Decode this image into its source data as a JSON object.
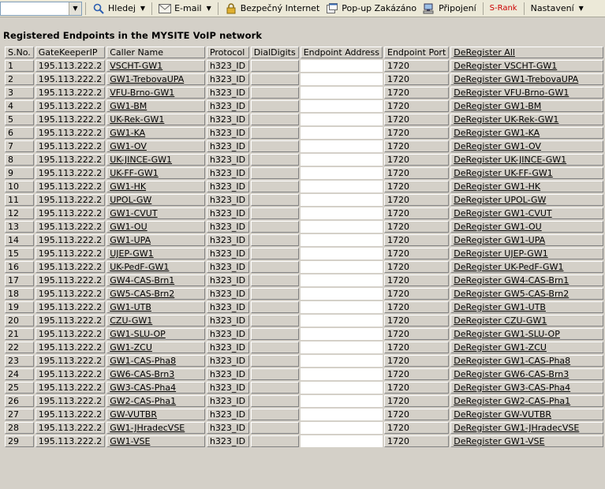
{
  "toolbar": {
    "search_label": "Hledej",
    "email_label": "E-mail",
    "secure_label": "Bezpečný Internet",
    "popup_label": "Pop-up Zakázáno",
    "connect_label": "Připojení",
    "srank_label": "S-Rank",
    "settings_label": "Nastavení"
  },
  "page": {
    "heading": "Registered Endpoints in the MYSITE VoIP network"
  },
  "table": {
    "headers": [
      "S.No.",
      "GateKeeperIP",
      "Caller Name",
      "Protocol",
      "DialDigits",
      "Endpoint Address",
      "Endpoint Port",
      "DeRegister All"
    ],
    "rows": [
      [
        "1",
        "195.113.222.2",
        "VSCHT-GW1",
        "h323_ID",
        "",
        "",
        "1720",
        "DeRegister VSCHT-GW1"
      ],
      [
        "2",
        "195.113.222.2",
        "GW1-TrebovaUPA",
        "h323_ID",
        "",
        "",
        "1720",
        "DeRegister GW1-TrebovaUPA"
      ],
      [
        "3",
        "195.113.222.2",
        "VFU-Brno-GW1",
        "h323_ID",
        "",
        "",
        "1720",
        "DeRegister VFU-Brno-GW1"
      ],
      [
        "4",
        "195.113.222.2",
        "GW1-BM",
        "h323_ID",
        "",
        "",
        "1720",
        "DeRegister GW1-BM"
      ],
      [
        "5",
        "195.113.222.2",
        "UK-Rek-GW1",
        "h323_ID",
        "",
        "",
        "1720",
        "DeRegister UK-Rek-GW1"
      ],
      [
        "6",
        "195.113.222.2",
        "GW1-KA",
        "h323_ID",
        "",
        "",
        "1720",
        "DeRegister GW1-KA"
      ],
      [
        "7",
        "195.113.222.2",
        "GW1-OV",
        "h323_ID",
        "",
        "",
        "1720",
        "DeRegister GW1-OV"
      ],
      [
        "8",
        "195.113.222.2",
        "UK-JINCE-GW1",
        "h323_ID",
        "",
        "",
        "1720",
        "DeRegister UK-JINCE-GW1"
      ],
      [
        "9",
        "195.113.222.2",
        "UK-FF-GW1",
        "h323_ID",
        "",
        "",
        "1720",
        "DeRegister UK-FF-GW1"
      ],
      [
        "10",
        "195.113.222.2",
        "GW1-HK",
        "h323_ID",
        "",
        "",
        "1720",
        "DeRegister GW1-HK"
      ],
      [
        "11",
        "195.113.222.2",
        "UPOL-GW",
        "h323_ID",
        "",
        "",
        "1720",
        "DeRegister UPOL-GW"
      ],
      [
        "12",
        "195.113.222.2",
        "GW1-CVUT",
        "h323_ID",
        "",
        "",
        "1720",
        "DeRegister GW1-CVUT"
      ],
      [
        "13",
        "195.113.222.2",
        "GW1-OU",
        "h323_ID",
        "",
        "",
        "1720",
        "DeRegister GW1-OU"
      ],
      [
        "14",
        "195.113.222.2",
        "GW1-UPA",
        "h323_ID",
        "",
        "",
        "1720",
        "DeRegister GW1-UPA"
      ],
      [
        "15",
        "195.113.222.2",
        "UJEP-GW1",
        "h323_ID",
        "",
        "",
        "1720",
        "DeRegister UJEP-GW1"
      ],
      [
        "16",
        "195.113.222.2",
        "UK-PedF-GW1",
        "h323_ID",
        "",
        "",
        "1720",
        "DeRegister UK-PedF-GW1"
      ],
      [
        "17",
        "195.113.222.2",
        "GW4-CAS-Brn1",
        "h323_ID",
        "",
        "",
        "1720",
        "DeRegister GW4-CAS-Brn1"
      ],
      [
        "18",
        "195.113.222.2",
        "GW5-CAS-Brn2",
        "h323_ID",
        "",
        "",
        "1720",
        "DeRegister GW5-CAS-Brn2"
      ],
      [
        "19",
        "195.113.222.2",
        "GW1-UTB",
        "h323_ID",
        "",
        "",
        "1720",
        "DeRegister GW1-UTB"
      ],
      [
        "20",
        "195.113.222.2",
        "CZU-GW1",
        "h323_ID",
        "",
        "",
        "1720",
        "DeRegister CZU-GW1"
      ],
      [
        "21",
        "195.113.222.2",
        "GW1-SLU-OP",
        "h323_ID",
        "",
        "",
        "1720",
        "DeRegister GW1-SLU-OP"
      ],
      [
        "22",
        "195.113.222.2",
        "GW1-ZCU",
        "h323_ID",
        "",
        "",
        "1720",
        "DeRegister GW1-ZCU"
      ],
      [
        "23",
        "195.113.222.2",
        "GW1-CAS-Pha8",
        "h323_ID",
        "",
        "",
        "1720",
        "DeRegister GW1-CAS-Pha8"
      ],
      [
        "24",
        "195.113.222.2",
        "GW6-CAS-Brn3",
        "h323_ID",
        "",
        "",
        "1720",
        "DeRegister GW6-CAS-Brn3"
      ],
      [
        "25",
        "195.113.222.2",
        "GW3-CAS-Pha4",
        "h323_ID",
        "",
        "",
        "1720",
        "DeRegister GW3-CAS-Pha4"
      ],
      [
        "26",
        "195.113.222.2",
        "GW2-CAS-Pha1",
        "h323_ID",
        "",
        "",
        "1720",
        "DeRegister GW2-CAS-Pha1"
      ],
      [
        "27",
        "195.113.222.2",
        "GW-VUTBR",
        "h323_ID",
        "",
        "",
        "1720",
        "DeRegister GW-VUTBR"
      ],
      [
        "28",
        "195.113.222.2",
        "GW1-JHradecVSE",
        "h323_ID",
        "",
        "",
        "1720",
        "DeRegister GW1-JHradecVSE"
      ],
      [
        "29",
        "195.113.222.2",
        "GW1-VSE",
        "h323_ID",
        "",
        "",
        "1720",
        "DeRegister GW1-VSE"
      ]
    ]
  }
}
